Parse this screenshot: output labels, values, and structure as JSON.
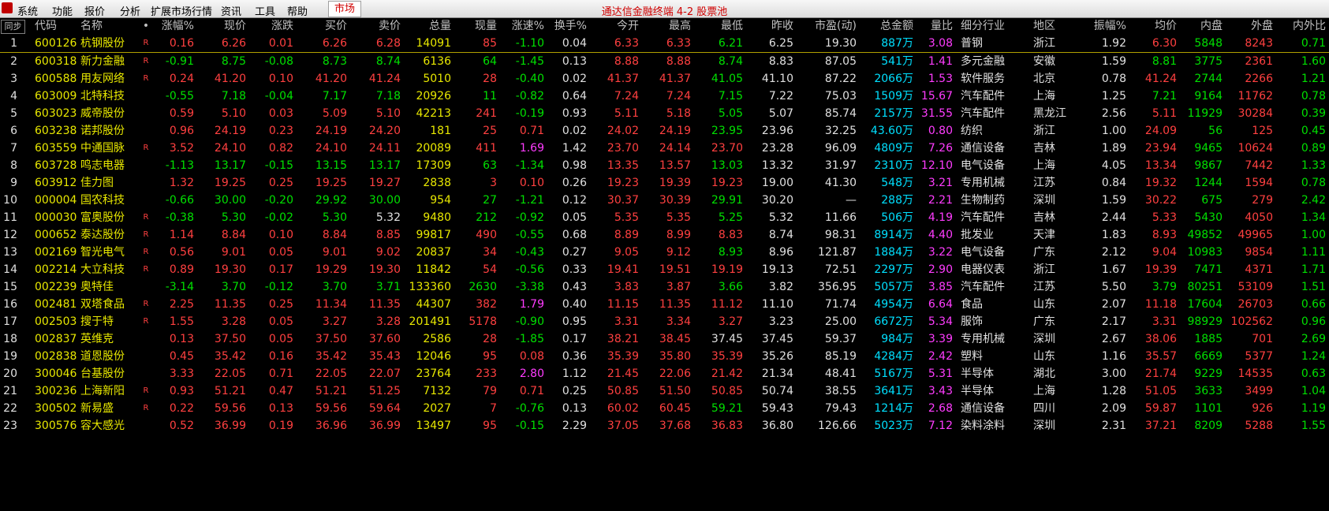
{
  "menu": {
    "items": [
      "系统",
      "功能",
      "报价",
      "分析",
      "扩展市场行情",
      "资讯",
      "工具",
      "帮助"
    ],
    "market_label": "市场",
    "title": "通达信金融终端  4-2 股票池"
  },
  "table": {
    "sync_label": "同步",
    "headers": [
      "代码",
      "名称",
      "•",
      "涨幅%",
      "现价",
      "涨跌",
      "买价",
      "卖价",
      "总量",
      "现量",
      "涨速%",
      "换手%",
      "今开",
      "最高",
      "最低",
      "昨收",
      "市盈(动)",
      "总金额",
      "量比",
      "细分行业",
      "地区",
      "振幅%",
      "均价",
      "内盘",
      "外盘",
      "内外比"
    ],
    "rows": [
      {
        "idx": "1",
        "code": "600126",
        "name": "杭钢股份",
        "mark": "R",
        "pct": "0.16",
        "price": "6.26",
        "chg": "0.01",
        "bid": "6.26",
        "ask": "6.28",
        "vol": "14091",
        "cur": "85",
        "speed": "-1.10",
        "turn": "0.04",
        "open": "6.33",
        "high": "6.33",
        "low": "6.21",
        "prev": "6.25",
        "pe": "19.30",
        "amt": "887",
        "ratio": "3.08",
        "ind": "普钢",
        "region": "浙江",
        "amp": "1.92",
        "avg": "6.30",
        "inner": "5848",
        "outer": "8243",
        "io": "0.71"
      },
      {
        "idx": "2",
        "code": "600318",
        "name": "新力金融",
        "mark": "R",
        "pct": "-0.91",
        "price": "8.75",
        "chg": "-0.08",
        "bid": "8.73",
        "ask": "8.74",
        "vol": "6136",
        "cur": "64",
        "speed": "-1.45",
        "turn": "0.13",
        "open": "8.88",
        "high": "8.88",
        "low": "8.74",
        "prev": "8.83",
        "pe": "87.05",
        "amt": "541",
        "ratio": "1.41",
        "ind": "多元金融",
        "region": "安徽",
        "amp": "1.59",
        "avg": "8.81",
        "inner": "3775",
        "outer": "2361",
        "io": "1.60"
      },
      {
        "idx": "3",
        "code": "600588",
        "name": "用友网络",
        "mark": "R",
        "pct": "0.24",
        "price": "41.20",
        "chg": "0.10",
        "bid": "41.20",
        "ask": "41.24",
        "vol": "5010",
        "cur": "28",
        "speed": "-0.40",
        "turn": "0.02",
        "open": "41.37",
        "high": "41.37",
        "low": "41.05",
        "prev": "41.10",
        "pe": "87.22",
        "amt": "2066",
        "ratio": "1.53",
        "ind": "软件服务",
        "region": "北京",
        "amp": "0.78",
        "avg": "41.24",
        "inner": "2744",
        "outer": "2266",
        "io": "1.21"
      },
      {
        "idx": "4",
        "code": "603009",
        "name": "北特科技",
        "mark": "",
        "pct": "-0.55",
        "price": "7.18",
        "chg": "-0.04",
        "bid": "7.17",
        "ask": "7.18",
        "vol": "20926",
        "cur": "11",
        "speed": "-0.82",
        "turn": "0.64",
        "open": "7.24",
        "high": "7.24",
        "low": "7.15",
        "prev": "7.22",
        "pe": "75.03",
        "amt": "1509",
        "ratio": "15.67",
        "ind": "汽车配件",
        "region": "上海",
        "amp": "1.25",
        "avg": "7.21",
        "inner": "9164",
        "outer": "11762",
        "io": "0.78"
      },
      {
        "idx": "5",
        "code": "603023",
        "name": "威帝股份",
        "mark": "",
        "pct": "0.59",
        "price": "5.10",
        "chg": "0.03",
        "bid": "5.09",
        "ask": "5.10",
        "vol": "42213",
        "cur": "241",
        "speed": "-0.19",
        "turn": "0.93",
        "open": "5.11",
        "high": "5.18",
        "low": "5.05",
        "prev": "5.07",
        "pe": "85.74",
        "amt": "2157",
        "ratio": "31.55",
        "ind": "汽车配件",
        "region": "黑龙江",
        "amp": "2.56",
        "avg": "5.11",
        "inner": "11929",
        "outer": "30284",
        "io": "0.39"
      },
      {
        "idx": "6",
        "code": "603238",
        "name": "诺邦股份",
        "mark": "",
        "pct": "0.96",
        "price": "24.19",
        "chg": "0.23",
        "bid": "24.19",
        "ask": "24.20",
        "vol": "181",
        "cur": "25",
        "speed": "0.71",
        "turn": "0.02",
        "open": "24.02",
        "high": "24.19",
        "low": "23.95",
        "prev": "23.96",
        "pe": "32.25",
        "amt": "43.60",
        "ratio": "0.80",
        "ind": "纺织",
        "region": "浙江",
        "amp": "1.00",
        "avg": "24.09",
        "inner": "56",
        "outer": "125",
        "io": "0.45"
      },
      {
        "idx": "7",
        "code": "603559",
        "name": "中通国脉",
        "mark": "R",
        "pct": "3.52",
        "price": "24.10",
        "chg": "0.82",
        "bid": "24.10",
        "ask": "24.11",
        "vol": "20089",
        "cur": "411",
        "speed": "1.69",
        "turn": "1.42",
        "open": "23.70",
        "high": "24.14",
        "low": "23.70",
        "prev": "23.28",
        "pe": "96.09",
        "amt": "4809",
        "ratio": "7.26",
        "ind": "通信设备",
        "region": "吉林",
        "amp": "1.89",
        "avg": "23.94",
        "inner": "9465",
        "outer": "10624",
        "io": "0.89"
      },
      {
        "idx": "8",
        "code": "603728",
        "name": "鸣志电器",
        "mark": "",
        "pct": "-1.13",
        "price": "13.17",
        "chg": "-0.15",
        "bid": "13.15",
        "ask": "13.17",
        "vol": "17309",
        "cur": "63",
        "speed": "-1.34",
        "turn": "0.98",
        "open": "13.35",
        "high": "13.57",
        "low": "13.03",
        "prev": "13.32",
        "pe": "31.97",
        "amt": "2310",
        "ratio": "12.10",
        "ind": "电气设备",
        "region": "上海",
        "amp": "4.05",
        "avg": "13.34",
        "inner": "9867",
        "outer": "7442",
        "io": "1.33"
      },
      {
        "idx": "9",
        "code": "603912",
        "name": "佳力图",
        "mark": "",
        "pct": "1.32",
        "price": "19.25",
        "chg": "0.25",
        "bid": "19.25",
        "ask": "19.27",
        "vol": "2838",
        "cur": "3",
        "speed": "0.10",
        "turn": "0.26",
        "open": "19.23",
        "high": "19.39",
        "low": "19.23",
        "prev": "19.00",
        "pe": "41.30",
        "amt": "548",
        "ratio": "3.21",
        "ind": "专用机械",
        "region": "江苏",
        "amp": "0.84",
        "avg": "19.32",
        "inner": "1244",
        "outer": "1594",
        "io": "0.78"
      },
      {
        "idx": "10",
        "code": "000004",
        "name": "国农科技",
        "mark": "",
        "pct": "-0.66",
        "price": "30.00",
        "chg": "-0.20",
        "bid": "29.92",
        "ask": "30.00",
        "vol": "954",
        "cur": "27",
        "speed": "-1.21",
        "turn": "0.12",
        "open": "30.37",
        "high": "30.39",
        "low": "29.91",
        "prev": "30.20",
        "pe": "—",
        "amt": "288",
        "ratio": "2.21",
        "ind": "生物制药",
        "region": "深圳",
        "amp": "1.59",
        "avg": "30.22",
        "inner": "675",
        "outer": "279",
        "io": "2.42"
      },
      {
        "idx": "11",
        "code": "000030",
        "name": "富奥股份",
        "mark": "R",
        "pct": "-0.38",
        "price": "5.30",
        "chg": "-0.02",
        "bid": "5.30",
        "ask": "5.32",
        "vol": "9480",
        "cur": "212",
        "speed": "-0.92",
        "turn": "0.05",
        "open": "5.35",
        "high": "5.35",
        "low": "5.25",
        "prev": "5.32",
        "pe": "11.66",
        "amt": "506",
        "ratio": "4.19",
        "ind": "汽车配件",
        "region": "吉林",
        "amp": "2.44",
        "avg": "5.33",
        "inner": "5430",
        "outer": "4050",
        "io": "1.34"
      },
      {
        "idx": "12",
        "code": "000652",
        "name": "泰达股份",
        "mark": "R",
        "pct": "1.14",
        "price": "8.84",
        "chg": "0.10",
        "bid": "8.84",
        "ask": "8.85",
        "vol": "99817",
        "cur": "490",
        "speed": "-0.55",
        "turn": "0.68",
        "open": "8.89",
        "high": "8.99",
        "low": "8.83",
        "prev": "8.74",
        "pe": "98.31",
        "amt": "8914",
        "ratio": "4.40",
        "ind": "批发业",
        "region": "天津",
        "amp": "1.83",
        "avg": "8.93",
        "inner": "49852",
        "outer": "49965",
        "io": "1.00"
      },
      {
        "idx": "13",
        "code": "002169",
        "name": "智光电气",
        "mark": "R",
        "pct": "0.56",
        "price": "9.01",
        "chg": "0.05",
        "bid": "9.01",
        "ask": "9.02",
        "vol": "20837",
        "cur": "34",
        "speed": "-0.43",
        "turn": "0.27",
        "open": "9.05",
        "high": "9.12",
        "low": "8.93",
        "prev": "8.96",
        "pe": "121.87",
        "amt": "1884",
        "ratio": "3.22",
        "ind": "电气设备",
        "region": "广东",
        "amp": "2.12",
        "avg": "9.04",
        "inner": "10983",
        "outer": "9854",
        "io": "1.11"
      },
      {
        "idx": "14",
        "code": "002214",
        "name": "大立科技",
        "mark": "R",
        "pct": "0.89",
        "price": "19.30",
        "chg": "0.17",
        "bid": "19.29",
        "ask": "19.30",
        "vol": "11842",
        "cur": "54",
        "speed": "-0.56",
        "turn": "0.33",
        "open": "19.41",
        "high": "19.51",
        "low": "19.19",
        "prev": "19.13",
        "pe": "72.51",
        "amt": "2297",
        "ratio": "2.90",
        "ind": "电器仪表",
        "region": "浙江",
        "amp": "1.67",
        "avg": "19.39",
        "inner": "7471",
        "outer": "4371",
        "io": "1.71"
      },
      {
        "idx": "15",
        "code": "002239",
        "name": "奥特佳",
        "mark": "",
        "pct": "-3.14",
        "price": "3.70",
        "chg": "-0.12",
        "bid": "3.70",
        "ask": "3.71",
        "vol": "133360",
        "cur": "2630",
        "speed": "-3.38",
        "turn": "0.43",
        "open": "3.83",
        "high": "3.87",
        "low": "3.66",
        "prev": "3.82",
        "pe": "356.95",
        "amt": "5057",
        "ratio": "3.85",
        "ind": "汽车配件",
        "region": "江苏",
        "amp": "5.50",
        "avg": "3.79",
        "inner": "80251",
        "outer": "53109",
        "io": "1.51"
      },
      {
        "idx": "16",
        "code": "002481",
        "name": "双塔食品",
        "mark": "R",
        "pct": "2.25",
        "price": "11.35",
        "chg": "0.25",
        "bid": "11.34",
        "ask": "11.35",
        "vol": "44307",
        "cur": "382",
        "speed": "1.79",
        "turn": "0.40",
        "open": "11.15",
        "high": "11.35",
        "low": "11.12",
        "prev": "11.10",
        "pe": "71.74",
        "amt": "4954",
        "ratio": "6.64",
        "ind": "食品",
        "region": "山东",
        "amp": "2.07",
        "avg": "11.18",
        "inner": "17604",
        "outer": "26703",
        "io": "0.66"
      },
      {
        "idx": "17",
        "code": "002503",
        "name": "搜于特",
        "mark": "R",
        "pct": "1.55",
        "price": "3.28",
        "chg": "0.05",
        "bid": "3.27",
        "ask": "3.28",
        "vol": "201491",
        "cur": "5178",
        "speed": "-0.90",
        "turn": "0.95",
        "open": "3.31",
        "high": "3.34",
        "low": "3.27",
        "prev": "3.23",
        "pe": "25.00",
        "amt": "6672",
        "ratio": "5.34",
        "ind": "服饰",
        "region": "广东",
        "amp": "2.17",
        "avg": "3.31",
        "inner": "98929",
        "outer": "102562",
        "io": "0.96"
      },
      {
        "idx": "18",
        "code": "002837",
        "name": "英维克",
        "mark": "",
        "pct": "0.13",
        "price": "37.50",
        "chg": "0.05",
        "bid": "37.50",
        "ask": "37.60",
        "vol": "2586",
        "cur": "28",
        "speed": "-1.85",
        "turn": "0.17",
        "open": "38.21",
        "high": "38.45",
        "low": "37.45",
        "prev": "37.45",
        "pe": "59.37",
        "amt": "984",
        "ratio": "3.39",
        "ind": "专用机械",
        "region": "深圳",
        "amp": "2.67",
        "avg": "38.06",
        "inner": "1885",
        "outer": "701",
        "io": "2.69"
      },
      {
        "idx": "19",
        "code": "002838",
        "name": "道恩股份",
        "mark": "",
        "pct": "0.45",
        "price": "35.42",
        "chg": "0.16",
        "bid": "35.42",
        "ask": "35.43",
        "vol": "12046",
        "cur": "95",
        "speed": "0.08",
        "turn": "0.36",
        "open": "35.39",
        "high": "35.80",
        "low": "35.39",
        "prev": "35.26",
        "pe": "85.19",
        "amt": "4284",
        "ratio": "2.42",
        "ind": "塑料",
        "region": "山东",
        "amp": "1.16",
        "avg": "35.57",
        "inner": "6669",
        "outer": "5377",
        "io": "1.24"
      },
      {
        "idx": "20",
        "code": "300046",
        "name": "台基股份",
        "mark": "",
        "pct": "3.33",
        "price": "22.05",
        "chg": "0.71",
        "bid": "22.05",
        "ask": "22.07",
        "vol": "23764",
        "cur": "233",
        "speed": "2.80",
        "turn": "1.12",
        "open": "21.45",
        "high": "22.06",
        "low": "21.42",
        "prev": "21.34",
        "pe": "48.41",
        "amt": "5167",
        "ratio": "5.31",
        "ind": "半导体",
        "region": "湖北",
        "amp": "3.00",
        "avg": "21.74",
        "inner": "9229",
        "outer": "14535",
        "io": "0.63"
      },
      {
        "idx": "21",
        "code": "300236",
        "name": "上海新阳",
        "mark": "R",
        "pct": "0.93",
        "price": "51.21",
        "chg": "0.47",
        "bid": "51.21",
        "ask": "51.25",
        "vol": "7132",
        "cur": "79",
        "speed": "0.71",
        "turn": "0.25",
        "open": "50.85",
        "high": "51.50",
        "low": "50.85",
        "prev": "50.74",
        "pe": "38.55",
        "amt": "3641",
        "ratio": "3.43",
        "ind": "半导体",
        "region": "上海",
        "amp": "1.28",
        "avg": "51.05",
        "inner": "3633",
        "outer": "3499",
        "io": "1.04"
      },
      {
        "idx": "22",
        "code": "300502",
        "name": "新易盛",
        "mark": "R",
        "pct": "0.22",
        "price": "59.56",
        "chg": "0.13",
        "bid": "59.56",
        "ask": "59.64",
        "vol": "2027",
        "cur": "7",
        "speed": "-0.76",
        "turn": "0.13",
        "open": "60.02",
        "high": "60.45",
        "low": "59.21",
        "prev": "59.43",
        "pe": "79.43",
        "amt": "1214",
        "ratio": "2.68",
        "ind": "通信设备",
        "region": "四川",
        "amp": "2.09",
        "avg": "59.87",
        "inner": "1101",
        "outer": "926",
        "io": "1.19"
      },
      {
        "idx": "23",
        "code": "300576",
        "name": "容大感光",
        "mark": "",
        "pct": "0.52",
        "price": "36.99",
        "chg": "0.19",
        "bid": "36.96",
        "ask": "36.99",
        "vol": "13497",
        "cur": "95",
        "speed": "-0.15",
        "turn": "2.29",
        "open": "37.05",
        "high": "37.68",
        "low": "36.83",
        "prev": "36.80",
        "pe": "126.66",
        "amt": "5023",
        "ratio": "7.12",
        "ind": "染料涂料",
        "region": "深圳",
        "amp": "2.31",
        "avg": "37.21",
        "inner": "8209",
        "outer": "5288",
        "io": "1.55"
      }
    ],
    "amount_unit": "万"
  },
  "colors": {
    "up": "#ff4040",
    "down": "#00e000",
    "flat": "#e0e0e0",
    "code": "#e8e800",
    "amount": "#00e0ff",
    "ratio": "#ff3cff"
  }
}
